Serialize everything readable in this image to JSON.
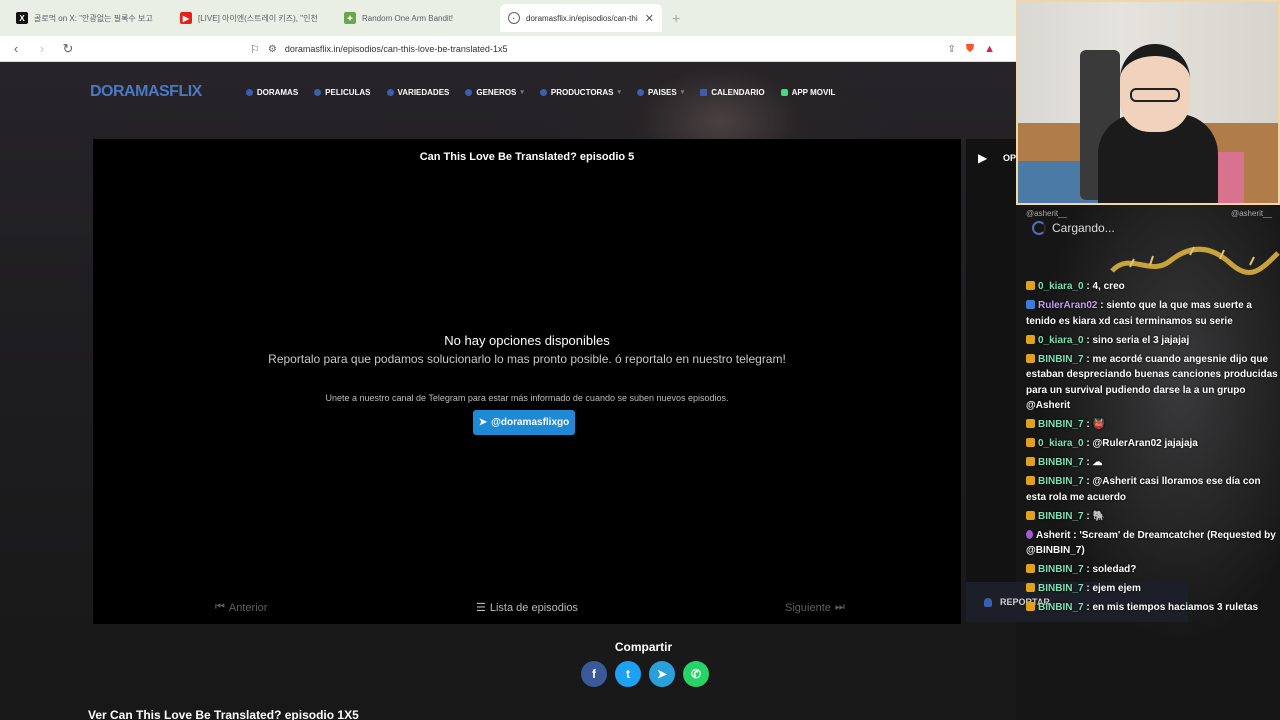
{
  "browser": {
    "tabs": [
      {
        "title": "골로먹 on X: \"안광없는 필록수 보고",
        "icon": "x-icon",
        "icon_color": "#111111",
        "active": false
      },
      {
        "title": "[LIVE] 아이엔(스트레이 키즈), \"인천",
        "icon": "youtube-icon",
        "icon_color": "#e62117",
        "active": false
      },
      {
        "title": "Random One Arm Bandit!",
        "icon": "puzzle-icon",
        "icon_color": "#6aa84f",
        "active": false
      },
      {
        "title": "doramasflix.in/episodios/can-thi",
        "icon": "globe-icon",
        "icon_color": "#5f6368",
        "active": true
      }
    ],
    "url": "doramasflix.in/episodios/can-this-love-be-translated-1x5"
  },
  "site": {
    "logo": "DORAMASFLIX",
    "nav": [
      {
        "label": "DORAMAS",
        "dropdown": false
      },
      {
        "label": "PELICULAS",
        "dropdown": false
      },
      {
        "label": "VARIEDADES",
        "dropdown": false
      },
      {
        "label": "GENEROS",
        "dropdown": true
      },
      {
        "label": "PRODUCTORAS",
        "dropdown": true
      },
      {
        "label": "PAISES",
        "dropdown": true
      },
      {
        "label": "CALENDARIO",
        "dropdown": false
      },
      {
        "label": "APP MOVIL",
        "dropdown": false
      }
    ],
    "player": {
      "title": "Can This Love Be Translated? episodio 5",
      "no_options": "No hay opciones disponibles",
      "report_text": "Reportalo para que podamos solucionarlo lo mas pronto posible. ó reportalo en nuestro telegram!",
      "telegram_text": "Unete a nuestro canal de Telegram para estar más informado de cuando se suben nuevos episodios.",
      "telegram_button": "@doramasflixgo",
      "prev": "Anterior",
      "list": "Lista de episodios",
      "next": "Siguiente"
    },
    "side_label": "OP",
    "report_label": "REPORTAR",
    "share_title": "Compartir",
    "share": [
      {
        "name": "facebook",
        "glyph": "f",
        "color": "#3b5998"
      },
      {
        "name": "twitter",
        "glyph": "t",
        "color": "#1da1f2"
      },
      {
        "name": "telegram",
        "glyph": "➤",
        "color": "#2aa0da"
      },
      {
        "name": "whatsapp",
        "glyph": "✆",
        "color": "#25d366"
      }
    ],
    "bottom_title": "Ver Can This Love Be Translated? episodio 1X5"
  },
  "chat": {
    "header_left": "@asherit__",
    "header_right": "@asherit__",
    "loading": "Cargando...",
    "messages": [
      {
        "user": "0_kiara_0",
        "text": ": 4, creo",
        "color": "green",
        "badge": "b1"
      },
      {
        "user": "RulerAran02",
        "text": ": siento que la que mas suerte a tenido es kiara xd casi terminamos su serie",
        "color": "purple",
        "badge": "b2"
      },
      {
        "user": "0_kiara_0",
        "text": ": sino seria el 3 jajajaj",
        "color": "green",
        "badge": "b1"
      },
      {
        "user": "BINBIN_7",
        "text": ": me acordé cuando angesnie dijo que estaban despreciando buenas canciones producidas para un survival pudiendo darse la a un grupo @Asherit",
        "color": "green",
        "badge": "b1"
      },
      {
        "user": "BINBIN_7",
        "text": ": 👹",
        "color": "green",
        "badge": "b1"
      },
      {
        "user": "0_kiara_0",
        "text": ": @RulerAran02 jajajaja",
        "color": "green",
        "badge": "b1"
      },
      {
        "user": "BINBIN_7",
        "text": ": ☁",
        "color": "green",
        "badge": "b1"
      },
      {
        "user": "BINBIN_7",
        "text": ": @Asherit casi lloramos ese día con esta rola me acuerdo",
        "color": "green",
        "badge": "b1"
      },
      {
        "user": "BINBIN_7",
        "text": ": 🐘",
        "color": "green",
        "badge": "b1"
      },
      {
        "user": "Asherit",
        "text": ": 'Scream' de Dreamcatcher (Requested by @BINBIN_7)",
        "color": "white",
        "badge": "purple"
      },
      {
        "user": "BINBIN_7",
        "text": ": soledad?",
        "color": "green",
        "badge": "b1"
      },
      {
        "user": "BINBIN_7",
        "text": ": ejem ejem",
        "color": "green",
        "badge": "b1"
      },
      {
        "user": "BINBIN_7",
        "text": ": en mis tiempos haciamos 3 ruletas",
        "color": "green",
        "badge": "b1"
      }
    ]
  }
}
